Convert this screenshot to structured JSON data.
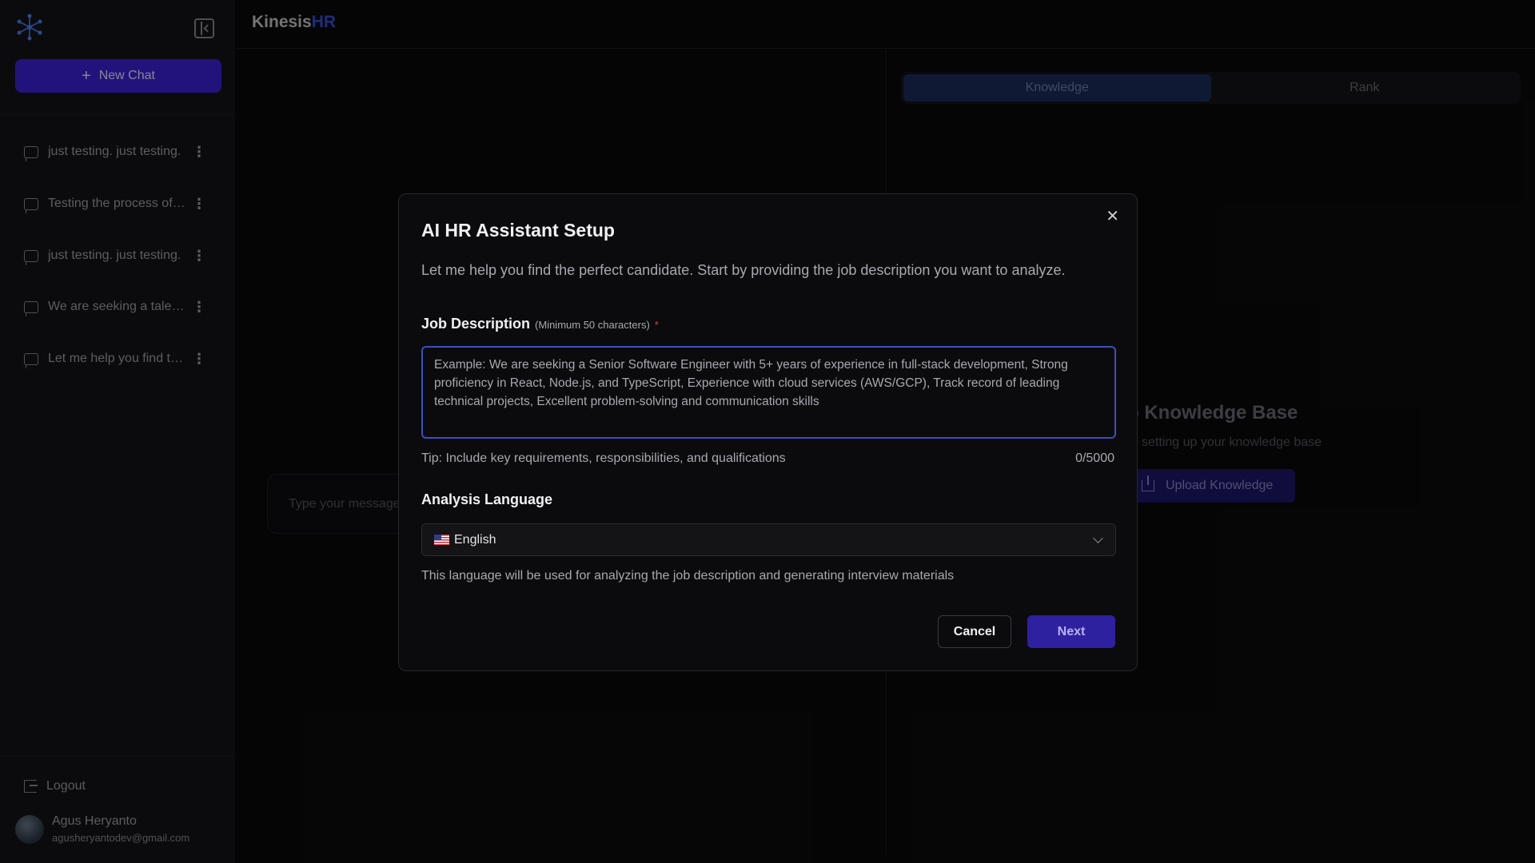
{
  "app": {
    "brand_main": "Kinesis",
    "brand_accent": "HR",
    "accent_color": "#3550d8"
  },
  "sidebar": {
    "new_chat_label": "New Chat",
    "chats": [
      {
        "label": "just testing. just testing."
      },
      {
        "label": "Testing the process of analysis"
      },
      {
        "label": "just testing. just testing."
      },
      {
        "label": "We are seeking a talented engineer"
      },
      {
        "label": "Let me help you find the perfect candidate"
      }
    ],
    "logout_label": "Logout",
    "user": {
      "name": "Agus Heryanto",
      "email": "agusheryantodev@gmail.com"
    }
  },
  "main": {
    "chat_placeholder": "Type your message..."
  },
  "right_panel": {
    "tabs": [
      {
        "label": "Knowledge",
        "active": true
      },
      {
        "label": "Rank",
        "active": false
      }
    ],
    "empty_title": "o Knowledge Base",
    "empty_subtitle": "setting up your knowledge base",
    "upload_label": "Upload Knowledge"
  },
  "modal": {
    "title": "AI HR Assistant Setup",
    "description": "Let me help you find the perfect candidate. Start by providing the job description you want to analyze.",
    "jd_label": "Job Description",
    "jd_min": "(Minimum 50 characters)",
    "jd_required": "*",
    "jd_placeholder": "Example: We are seeking a Senior Software Engineer with 5+ years of experience in full-stack development, Strong proficiency in React, Node.js, and TypeScript, Experience with cloud services (AWS/GCP), Track record of leading technical projects, Excellent problem-solving and communication skills",
    "tip": "Tip: Include key requirements, responsibilities, and qualifications",
    "count": "0/5000",
    "lang_label": "Analysis Language",
    "lang_selected": "English",
    "lang_note": "This language will be used for analyzing the job description and generating interview materials",
    "cancel_label": "Cancel",
    "next_label": "Next"
  }
}
